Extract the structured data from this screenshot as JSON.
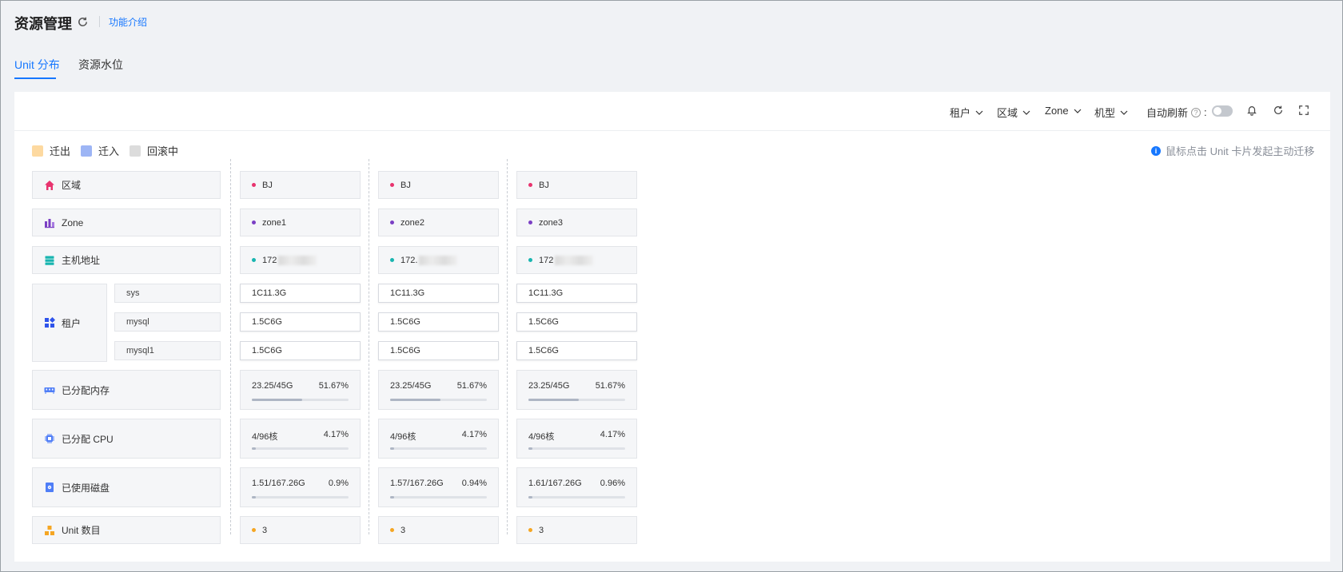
{
  "header": {
    "title": "资源管理",
    "intro_link": "功能介绍"
  },
  "tabs": [
    {
      "label": "Unit 分布",
      "active": true
    },
    {
      "label": "资源水位",
      "active": false
    }
  ],
  "toolbar": {
    "filters": [
      "租户",
      "区域",
      "Zone",
      "机型"
    ],
    "auto_refresh_label": "自动刷新",
    "auto_refresh_colon": ":",
    "auto_refresh_on": false
  },
  "legend": [
    {
      "label": "迁出",
      "color": "#fdd9a0"
    },
    {
      "label": "迁入",
      "color": "#9db5f5"
    },
    {
      "label": "回滚中",
      "color": "#dcdcdc"
    }
  ],
  "hint": "鼠标点击 Unit 卡片发起主动迁移",
  "rows": {
    "region": "区域",
    "zone": "Zone",
    "host": "主机地址",
    "tenant": "租户",
    "tenants": [
      "sys",
      "mysql",
      "mysql1"
    ],
    "memory": "已分配内存",
    "cpu": "已分配 CPU",
    "disk": "已使用磁盘",
    "units": "Unit 数目"
  },
  "colors": {
    "accent": "#1677ff",
    "region_dot": "#e8336e",
    "zone_dot": "#7b3fc4",
    "host_dot": "#19b5b0",
    "unit_dot": "#f5a623"
  },
  "zones": [
    {
      "region": "BJ",
      "zone": "zone1",
      "host": "172",
      "tenants": [
        "1C11.3G",
        "1.5C6G",
        "1.5C6G"
      ],
      "memory": {
        "value": "23.25/45G",
        "percent": "51.67%",
        "ratio": 0.5167
      },
      "cpu": {
        "value": "4/96核",
        "percent": "4.17%",
        "ratio": 0.0417
      },
      "disk": {
        "value": "1.51/167.26G",
        "percent": "0.9%",
        "ratio": 0.009
      },
      "units": "3"
    },
    {
      "region": "BJ",
      "zone": "zone2",
      "host": "172.",
      "tenants": [
        "1C11.3G",
        "1.5C6G",
        "1.5C6G"
      ],
      "memory": {
        "value": "23.25/45G",
        "percent": "51.67%",
        "ratio": 0.5167
      },
      "cpu": {
        "value": "4/96核",
        "percent": "4.17%",
        "ratio": 0.0417
      },
      "disk": {
        "value": "1.57/167.26G",
        "percent": "0.94%",
        "ratio": 0.0094
      },
      "units": "3"
    },
    {
      "region": "BJ",
      "zone": "zone3",
      "host": "172",
      "tenants": [
        "1C11.3G",
        "1.5C6G",
        "1.5C6G"
      ],
      "memory": {
        "value": "23.25/45G",
        "percent": "51.67%",
        "ratio": 0.5167
      },
      "cpu": {
        "value": "4/96核",
        "percent": "4.17%",
        "ratio": 0.0417
      },
      "disk": {
        "value": "1.61/167.26G",
        "percent": "0.96%",
        "ratio": 0.0096
      },
      "units": "3"
    }
  ]
}
